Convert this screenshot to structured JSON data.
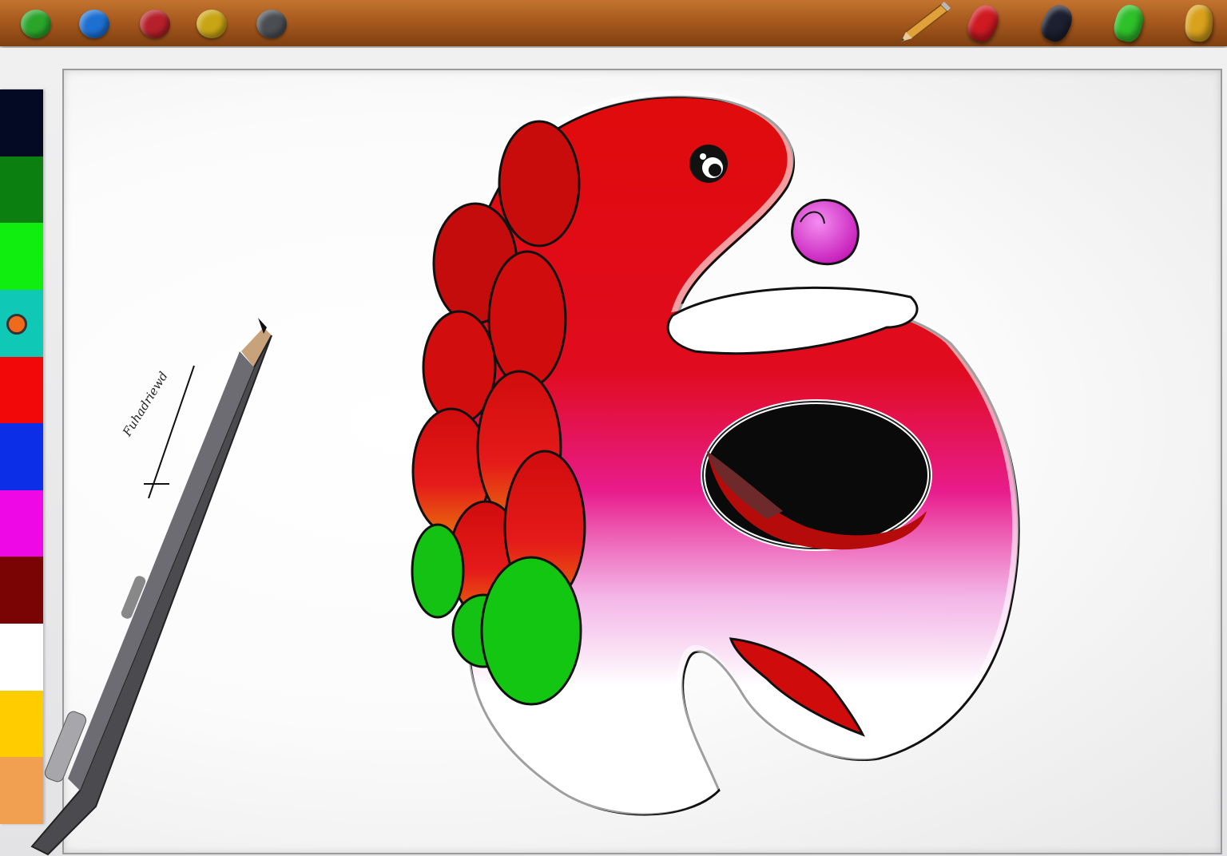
{
  "toolbar": {
    "color_dots": [
      {
        "name": "green-color-dot",
        "color": "#2aa52a"
      },
      {
        "name": "blue-color-dot",
        "color": "#1d6fd0"
      },
      {
        "name": "red-color-dot",
        "color": "#b5202a"
      },
      {
        "name": "yellow-color-dot",
        "color": "#c8a514"
      },
      {
        "name": "dark-gray-color-dot",
        "color": "#4a4d52"
      }
    ],
    "markers": [
      {
        "name": "red-marker",
        "color": "#d01a22"
      },
      {
        "name": "black-marker",
        "color": "#1c2030"
      },
      {
        "name": "green-marker",
        "color": "#2fc12a"
      },
      {
        "name": "yellow-marker",
        "color": "#d9a21d"
      }
    ],
    "icons": [
      "pencil-icon"
    ]
  },
  "palette": {
    "swatches": [
      {
        "name": "swatch-navy",
        "color": "#050a24"
      },
      {
        "name": "swatch-dark-green",
        "color": "#0b7f10"
      },
      {
        "name": "swatch-green",
        "color": "#10ee10"
      },
      {
        "name": "swatch-teal-selected",
        "color": "#0fc8b6"
      },
      {
        "name": "swatch-red",
        "color": "#f20808"
      },
      {
        "name": "swatch-blue",
        "color": "#0c2ee6"
      },
      {
        "name": "swatch-magenta",
        "color": "#ee08e6"
      },
      {
        "name": "swatch-maroon",
        "color": "#7a0404"
      },
      {
        "name": "swatch-white",
        "color": "#ffffff"
      },
      {
        "name": "swatch-yellow",
        "color": "#ffcc00"
      },
      {
        "name": "swatch-orange",
        "color": "#f0a050"
      }
    ]
  },
  "canvas": {
    "signature": "Fuhadriewd",
    "colors": {
      "red": "#e00b0b",
      "pink": "#e81c8c",
      "magenta": "#cc33cc",
      "green": "#12c412",
      "bubble": "#e03ad8",
      "mouth": "#0a0a0a"
    }
  }
}
